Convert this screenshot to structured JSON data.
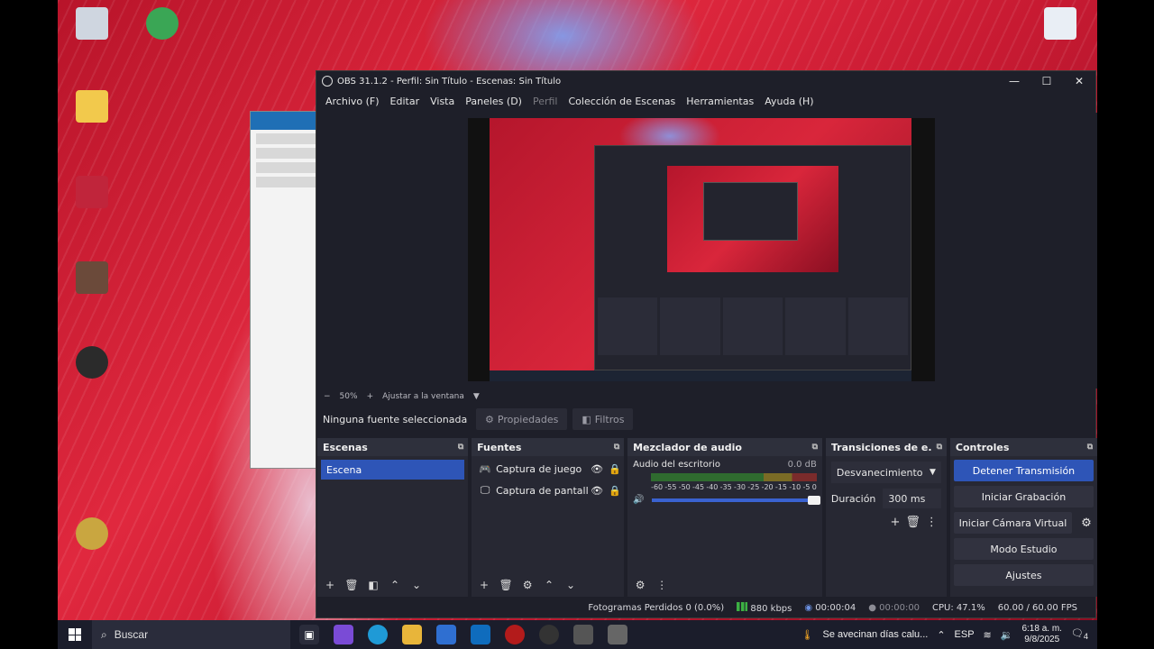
{
  "window": {
    "title": "OBS 31.1.2 - Perfil: Sin Título - Escenas: Sin Título",
    "minimize": "—",
    "maximize": "☐",
    "close": "✕"
  },
  "menu": [
    {
      "label": "Archivo (F)",
      "disabled": false
    },
    {
      "label": "Editar",
      "disabled": false
    },
    {
      "label": "Vista",
      "disabled": false
    },
    {
      "label": "Paneles (D)",
      "disabled": false
    },
    {
      "label": "Perfil",
      "disabled": true
    },
    {
      "label": "Colección de Escenas",
      "disabled": false
    },
    {
      "label": "Herramientas",
      "disabled": false
    },
    {
      "label": "Ayuda (H)",
      "disabled": false
    }
  ],
  "zoombar": {
    "minus": "−",
    "zoom": "50%",
    "plus": "+",
    "fit": "Ajustar a la ventana",
    "arrow": "▼"
  },
  "sourcebar": {
    "no_source": "Ninguna fuente seleccionada",
    "properties": "Propiedades",
    "filters": "Filtros"
  },
  "scenes": {
    "title": "Escenas",
    "items": [
      "Escena"
    ]
  },
  "sources": {
    "title": "Fuentes",
    "items": [
      {
        "name": "Captura de juego",
        "icon": "gamepad-icon"
      },
      {
        "name": "Captura de pantalla",
        "icon": "monitor-icon"
      }
    ]
  },
  "mixer": {
    "title": "Mezclador de audio",
    "channel": "Audio del escritorio",
    "db": "0.0 dB",
    "ticks": [
      "-60",
      "-55",
      "-50",
      "-45",
      "-40",
      "-35",
      "-30",
      "-25",
      "-20",
      "-15",
      "-10",
      "-5",
      "0"
    ],
    "volume": 1.0
  },
  "transitions": {
    "title": "Transiciones de e...",
    "selected": "Desvanecimiento",
    "duration_label": "Duración",
    "duration_value": "300 ms"
  },
  "controls": {
    "title": "Controles",
    "buttons": [
      "Detener Transmisión",
      "Iniciar Grabación",
      "Iniciar Cámara Virtual",
      "Modo Estudio",
      "Ajustes"
    ]
  },
  "status": {
    "dropped": "Fotogramas Perdidos 0 (0.0%)",
    "bitrate": "880 kbps",
    "stream_time": "00:00:04",
    "rec_time": "00:00:00",
    "cpu": "CPU: 47.1%",
    "fps": "60.00 / 60.00 FPS"
  },
  "taskbar": {
    "search": "Buscar",
    "weather": "Se avecinan días calu...",
    "lang": "ESP",
    "time": "6:18 a. m.",
    "date": "9/8/2025",
    "notifications": "4"
  },
  "colors": {
    "accent": "#2e55b7",
    "panel": "#272833",
    "background": "#1e1f29"
  }
}
